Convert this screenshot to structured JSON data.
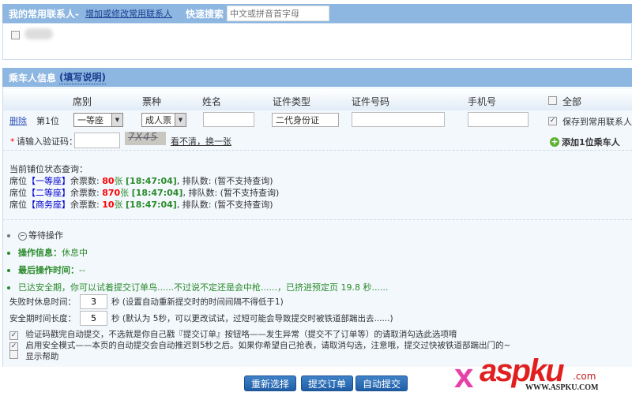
{
  "contacts": {
    "title": "我的常用联系人-",
    "edit_link": "增加或修改常用联系人",
    "search_label": "快速搜索",
    "search_placeholder": "中文或拼音首字母"
  },
  "passenger": {
    "title": "乘车人信息",
    "help_link": "(填写说明)",
    "headers": [
      "席别",
      "票种",
      "姓名",
      "证件类型",
      "证件号码",
      "手机号",
      "全部"
    ],
    "row": {
      "delete": "删除",
      "index": "第1位",
      "seat": "一等座",
      "ticket": "成人票",
      "name": "",
      "id_type": "二代身份证",
      "id_no": "",
      "phone": "",
      "save": "保存到常用联系人"
    },
    "captcha_label": "请输入验证码：",
    "captcha_image": "7X45",
    "captcha_refresh": "看不清，换一张",
    "add": "添加1位乘车人"
  },
  "status": {
    "title": "当前铺位状态查询：",
    "rows": [
      {
        "pre": "席位",
        "seat": "【一等座】",
        "mid": "余票数: ",
        "count": "80",
        "unit": "张",
        "time": "[18:47:04]",
        "queue": ", 排队数: (暂不支持查询)"
      },
      {
        "pre": "席位",
        "seat": "【二等座】",
        "mid": "余票数: ",
        "count": "870",
        "unit": "张",
        "time": "[18:47:04]",
        "queue": ", 排队数: (暂不支持查询)"
      },
      {
        "pre": "席位",
        "seat": "【商务座】",
        "mid": "余票数: ",
        "count": "10",
        "unit": "张",
        "time": "[18:47:04]",
        "queue": ", 排队数: (暂不支持查询)"
      }
    ]
  },
  "ops": {
    "waiting": "等待操作",
    "info_label": "操作信息：",
    "info_value": "休息中",
    "last_label": "最后操作时间：",
    "last_value": "--",
    "safe_msg": "已达安全期，你可以试着提交订单鸟......不过说不定还是会中枪......，已挤进预定页 19.8 秒......"
  },
  "settings": {
    "fail_label": "失败时休息时间：",
    "fail_value": "3",
    "fail_note": "秒 (设置自动重新提交时的时间间隔不得低于1)",
    "safe_label": "安全期时间长度：",
    "safe_value": "5",
    "safe_note": "秒 (默认为 5秒，可以更改试试，过短可能会导致提交时被铁道部踹出去......)",
    "opt1": "验证码戳完自动提交，不选就是你自己戳『提交订单』按钮咯——发生异常（提交不了订单等）的请取消勾选此选项唷",
    "opt2": "启用安全模式——本页的自动提交会自动推迟到5秒之后。如果你希望自己抢表，请取消勾选，注意哦，提交过快被铁道部踹出门的~",
    "opt3": "显示帮助"
  },
  "buttons": {
    "reset": "重新选择",
    "submit": "提交订单",
    "auto": "自动提交"
  },
  "watermark": {
    "logo": "aspku.com",
    "site": "WWW.ASPKU.COM"
  }
}
